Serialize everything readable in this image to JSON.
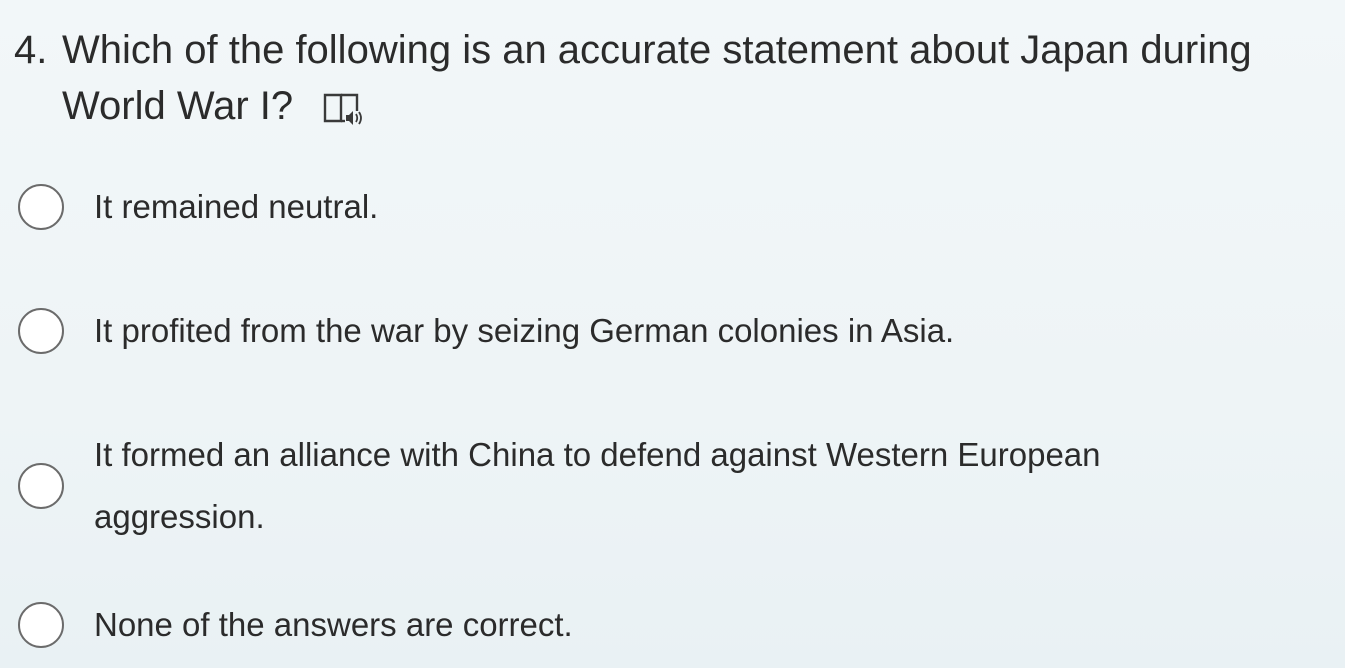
{
  "question": {
    "number": "4.",
    "text": "Which of the following is an accurate statement about Japan during World War I?",
    "tts_icon": "read-aloud-book-icon"
  },
  "options": [
    {
      "label": "It remained neutral.",
      "selected": false
    },
    {
      "label": "It profited from the war by seizing German colonies in Asia.",
      "selected": false
    },
    {
      "label": "It formed an alliance with China to defend against Western European aggression.",
      "selected": false
    },
    {
      "label": "None of the answers are correct.",
      "selected": false
    }
  ],
  "colors": {
    "background": "#eef4f6",
    "text": "#2b2b2b",
    "radio_border": "#6b6b6b"
  }
}
